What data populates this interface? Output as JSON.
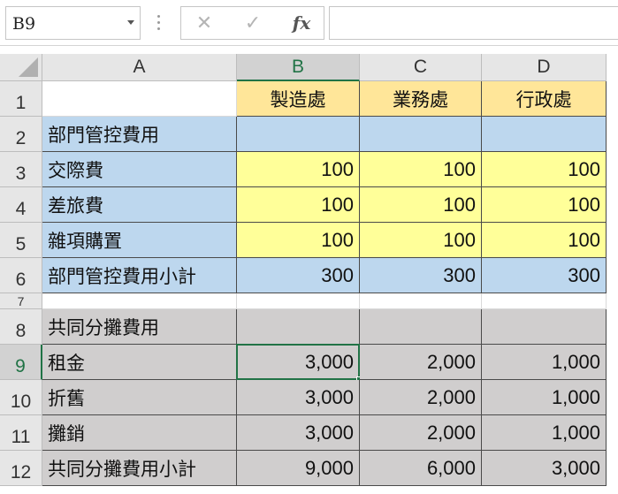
{
  "formula_bar": {
    "name_box": "B9",
    "cancel_glyph": "✕",
    "enter_glyph": "✓",
    "fx_label": "fx",
    "formula": ""
  },
  "colors": {
    "header_yellow": "#ffe699",
    "blue": "#bdd7ee",
    "yellow": "#ffff99",
    "gray": "#d0cece",
    "selection": "#217346"
  },
  "columns": [
    "A",
    "B",
    "C",
    "D"
  ],
  "rows": [
    {
      "num": "1",
      "cells": [
        "",
        "製造處",
        "業務處",
        "行政處"
      ]
    },
    {
      "num": "2",
      "cells": [
        "部門管控費用",
        "",
        "",
        ""
      ]
    },
    {
      "num": "3",
      "cells": [
        "交際費",
        "100",
        "100",
        "100"
      ]
    },
    {
      "num": "4",
      "cells": [
        "差旅費",
        "100",
        "100",
        "100"
      ]
    },
    {
      "num": "5",
      "cells": [
        "雜項購置",
        "100",
        "100",
        "100"
      ]
    },
    {
      "num": "6",
      "cells": [
        "部門管控費用小計",
        "300",
        "300",
        "300"
      ]
    },
    {
      "num": "7",
      "cells": [
        "",
        "",
        "",
        ""
      ]
    },
    {
      "num": "8",
      "cells": [
        "共同分攤費用",
        "",
        "",
        ""
      ]
    },
    {
      "num": "9",
      "cells": [
        "租金",
        "3,000",
        "2,000",
        "1,000"
      ]
    },
    {
      "num": "10",
      "cells": [
        "折舊",
        "3,000",
        "2,000",
        "1,000"
      ]
    },
    {
      "num": "11",
      "cells": [
        "攤銷",
        "3,000",
        "2,000",
        "1,000"
      ]
    },
    {
      "num": "12",
      "cells": [
        "共同分攤費用小計",
        "9,000",
        "6,000",
        "3,000"
      ]
    }
  ],
  "selected_cell": "B9"
}
